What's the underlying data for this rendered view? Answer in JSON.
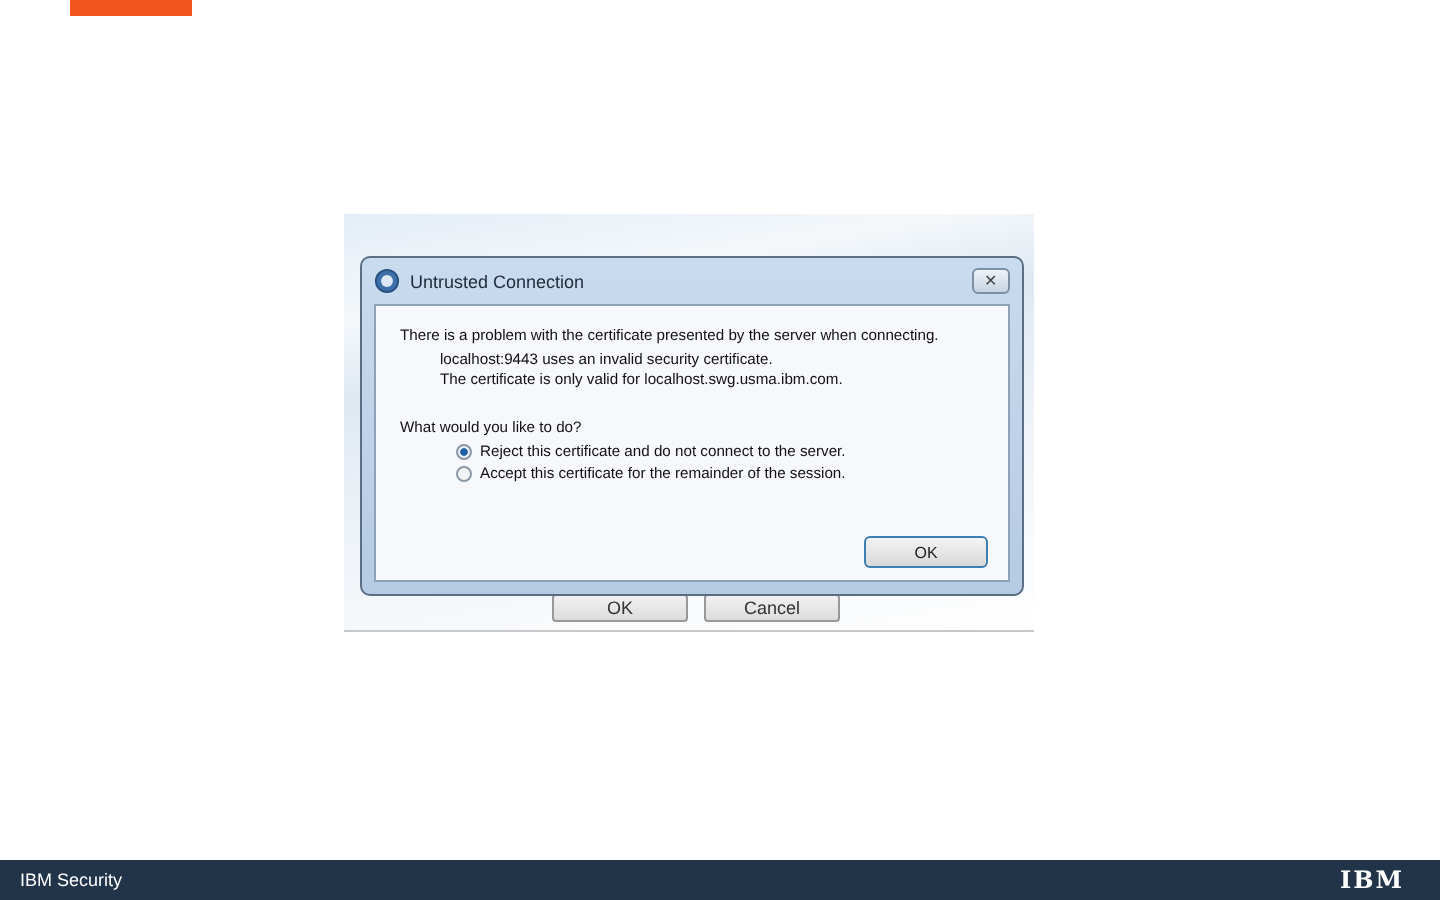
{
  "screenshot": {
    "background_buttons": [
      "OK",
      "Cancel"
    ],
    "dialog": {
      "title": "Untrusted Connection",
      "close": "✕",
      "message": "There is a problem with the certificate presented by the server when connecting.",
      "details": [
        "localhost:9443 uses an invalid security certificate.",
        "The certificate is only valid for localhost.swg.usma.ibm.com."
      ],
      "question": "What would you like to do?",
      "options": [
        {
          "label": "Reject this certificate and do not connect to the server.",
          "selected": true
        },
        {
          "label": "Accept this certificate for the remainder of the session.",
          "selected": false
        }
      ],
      "buttons": [
        "OK"
      ]
    }
  },
  "footer": {
    "text": "IBM Security",
    "logo": "IBM"
  }
}
